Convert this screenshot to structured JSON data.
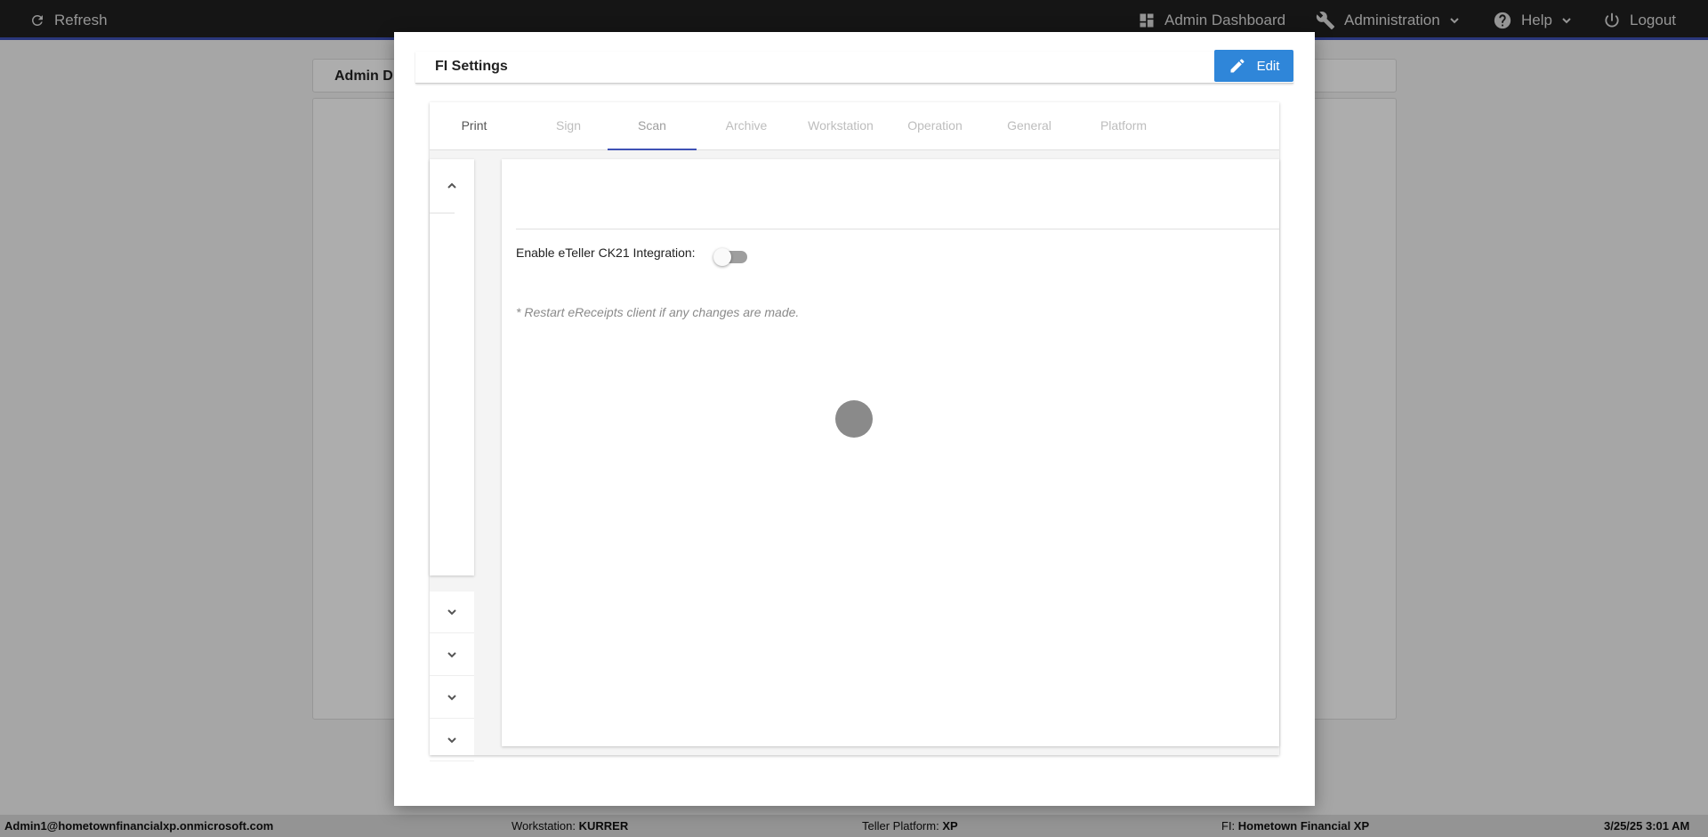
{
  "topbar": {
    "refresh_label": "Refresh",
    "admin_dashboard_label": "Admin Dashboard",
    "administration_label": "Administration",
    "help_label": "Help",
    "logout_label": "Logout"
  },
  "background": {
    "header_title": "Admin D"
  },
  "modal": {
    "title": "FI Settings",
    "edit_label": "Edit",
    "tabs": [
      {
        "label": "Print"
      },
      {
        "label": "Sign"
      },
      {
        "label": "Scan"
      },
      {
        "label": "Archive"
      },
      {
        "label": "Workstation"
      },
      {
        "label": "Operation"
      },
      {
        "label": "General"
      },
      {
        "label": "Platform"
      }
    ],
    "active_tab": "Scan",
    "toggle_label": "Enable eTeller CK21 Integration:",
    "toggle_on": false,
    "note": "* Restart eReceipts client if any changes are made."
  },
  "statusbar": {
    "user": "Admin1@hometownfinancialxp.onmicrosoft.com",
    "workstation_label": "Workstation: ",
    "workstation_value": "KURRER",
    "teller_label": "Teller Platform: ",
    "teller_value": "XP",
    "fi_label": "FI: ",
    "fi_value": "Hometown Financial XP",
    "datetime": "3/25/25 3:01 AM"
  },
  "icons": [
    "refresh-icon",
    "dashboard-icon",
    "wrench-icon",
    "help-icon",
    "power-icon",
    "pencil-icon",
    "chevron-up-icon",
    "chevron-down-icon"
  ],
  "colors": {
    "accent": "#3f51b5",
    "edit_button": "#2f86d9",
    "topbar": "#1f1f1f"
  }
}
